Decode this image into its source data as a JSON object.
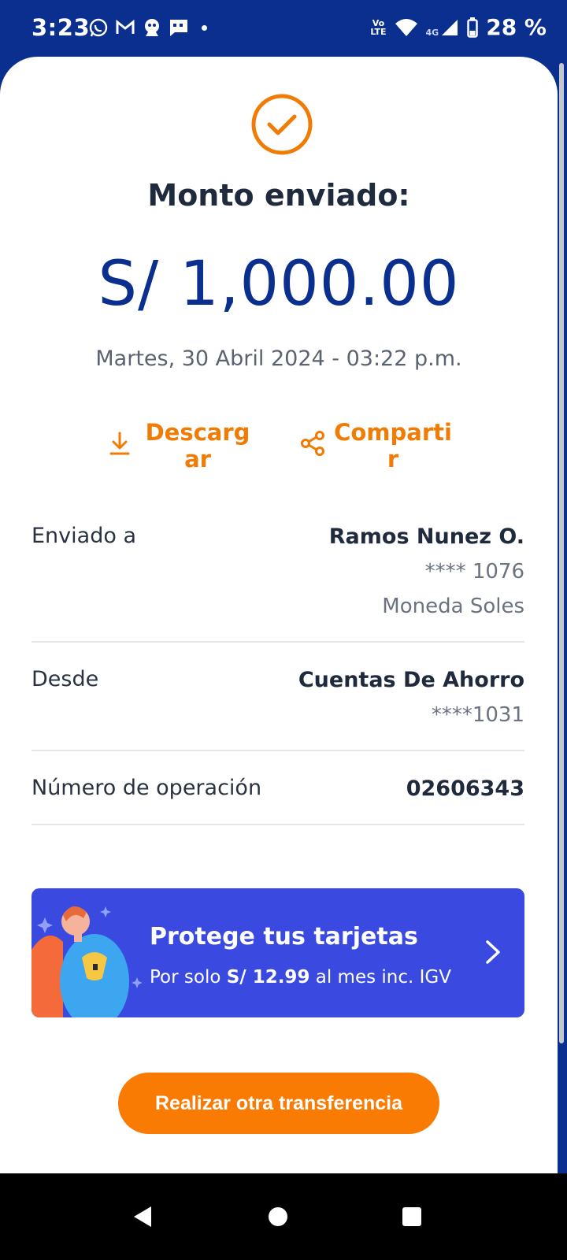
{
  "status_bar": {
    "time": "3:23",
    "network_label_top": "Vo",
    "network_label_bottom": "LTE",
    "signal_label": "4G",
    "battery_percent": "28 %",
    "icons": [
      "whatsapp-icon",
      "gmail-icon",
      "alien-icon",
      "message-icon",
      "dot-icon",
      "volte-icon",
      "wifi-icon",
      "signal-icon",
      "battery-icon"
    ]
  },
  "success": {
    "icon": "check-circle-icon",
    "title": "Monto enviado:",
    "amount": "S/ 1,000.00",
    "date": "Martes, 30 Abril 2024 - 03:22 p.m."
  },
  "actions": {
    "download_label": "Descargar",
    "share_label": "Compartir",
    "accent_color": "#f07b05"
  },
  "details": {
    "sent_to": {
      "label": "Enviado a",
      "name": "Ramos Nunez O.",
      "account": "**** 1076",
      "currency": "Moneda Soles"
    },
    "from": {
      "label": "Desde",
      "name": "Cuentas De Ahorro",
      "account": "****1031"
    },
    "operation": {
      "label": "Número de operación",
      "number": "02606343"
    }
  },
  "banner": {
    "title": "Protege tus tarjetas",
    "sub_prefix": "Por solo ",
    "sub_price": "S/ 12.99",
    "sub_suffix": " al mes inc. IGV",
    "background": "#3a4ae0"
  },
  "cta": {
    "label": "Realizar otra transferencia",
    "color": "#f97b03"
  },
  "nav": {
    "back": "back-icon",
    "home": "home-icon",
    "recents": "recents-icon"
  }
}
